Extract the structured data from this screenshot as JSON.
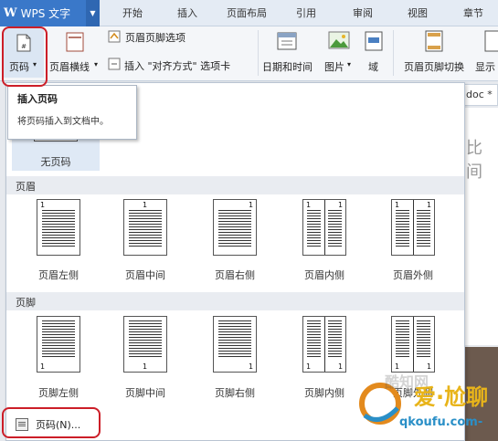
{
  "titlebar": {
    "app_logo": "W",
    "app_name": "WPS 文字",
    "app_arrow": "▼",
    "tabs": [
      "开始",
      "插入",
      "页面布局",
      "引用",
      "审阅",
      "视图",
      "章节"
    ]
  },
  "ribbon": {
    "page_number": "页码",
    "header_line": "页眉横线",
    "header_footer_options": "页眉页脚选项",
    "insert_align_tab": "插入 \"对齐方式\" 选项卡",
    "date_time": "日期和时间",
    "picture": "图片",
    "field": "域",
    "switch_header_footer": "页眉页脚切换",
    "show_prev": "显示"
  },
  "document": {
    "tab_label": "doc *",
    "visible_text": "比间"
  },
  "dropdown": {
    "no_page_label": "无页码",
    "header_section": "页眉",
    "footer_section": "页脚",
    "header_items": [
      "页眉左侧",
      "页眉中间",
      "页眉右侧",
      "页眉内侧",
      "页眉外侧"
    ],
    "footer_items": [
      "页脚左侧",
      "页脚中间",
      "页脚右侧",
      "页脚内侧",
      "页脚外侧"
    ],
    "page_num_marker": "1",
    "footer_action": "页码(N)..."
  },
  "tooltip": {
    "title": "插入页码",
    "body": "将页码插入到文档中。"
  },
  "watermark": {
    "brand": "爱·尬聊",
    "ghost": "酷知网",
    "site": "qkoufu.com-"
  },
  "colors": {
    "app_menu": "#3a78c9",
    "highlight": "#cc1e28",
    "section_header": "#e9ecf1",
    "no_page_bg": "#dfe9f5"
  }
}
